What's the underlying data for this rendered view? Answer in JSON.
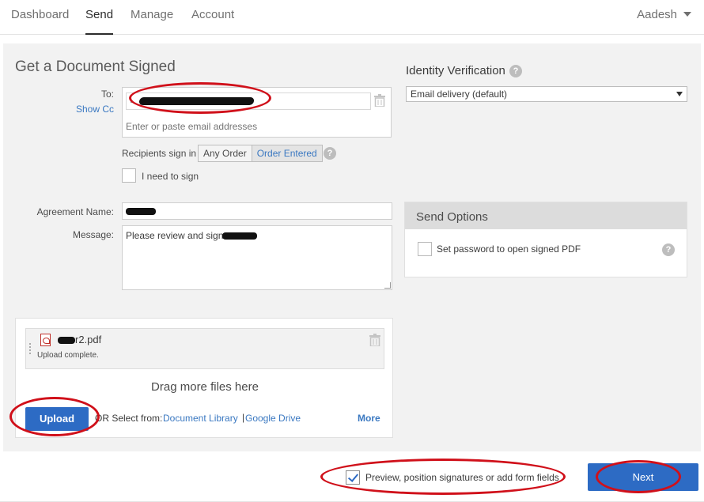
{
  "nav": {
    "tabs": [
      "Dashboard",
      "Send",
      "Manage",
      "Account"
    ],
    "active_tab": "Send",
    "user_name": "Aadesh"
  },
  "form": {
    "title": "Get a Document Signed",
    "to_label": "To:",
    "show_cc": "Show Cc",
    "to_placeholder": "Enter or paste email addresses",
    "recipients_sign_in_label": "Recipients sign in",
    "sign_order_options": [
      "Any Order",
      "Order Entered"
    ],
    "sign_order_selected": "Order Entered",
    "need_to_sign_label": "I need to sign",
    "agreement_name_label": "Agreement Name:",
    "message_label": "Message:",
    "message_value": "Please review and sign"
  },
  "identity": {
    "title": "Identity Verification",
    "selected": "Email delivery (default)"
  },
  "send_options": {
    "title": "Send Options",
    "password_label": "Set password to open signed PDF"
  },
  "upload": {
    "file_name_suffix": "r2.pdf",
    "status": "Upload complete.",
    "drag_text": "Drag more files here",
    "upload_button": "Upload",
    "or_text": "OR Select from:",
    "document_library": "Document Library",
    "separator": "|",
    "google_drive": "Google Drive",
    "more": "More"
  },
  "footer": {
    "preview_label": "Preview, position signatures or add form fields",
    "preview_checked": true,
    "next_button": "Next"
  },
  "colors": {
    "accent": "#2d6bc4",
    "link": "#3a78c1",
    "annotation": "#d0101a"
  }
}
